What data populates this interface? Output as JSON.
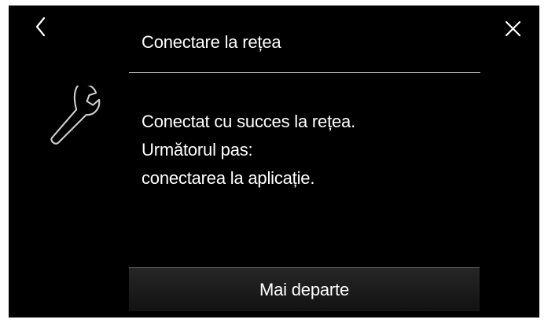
{
  "header": {
    "title": "Conectare la rețea",
    "back_icon": "chevron-left-icon",
    "close_icon": "close-icon"
  },
  "status_icon": "wrench-icon",
  "message": {
    "line1": "Conectat cu succes la rețea.",
    "line2": "Următorul pas:",
    "line3": "conectarea la aplicație."
  },
  "actions": {
    "continue_label": "Mai departe"
  },
  "colors": {
    "background": "#000000",
    "text": "#ffffff",
    "divider": "#d9d9d9"
  }
}
